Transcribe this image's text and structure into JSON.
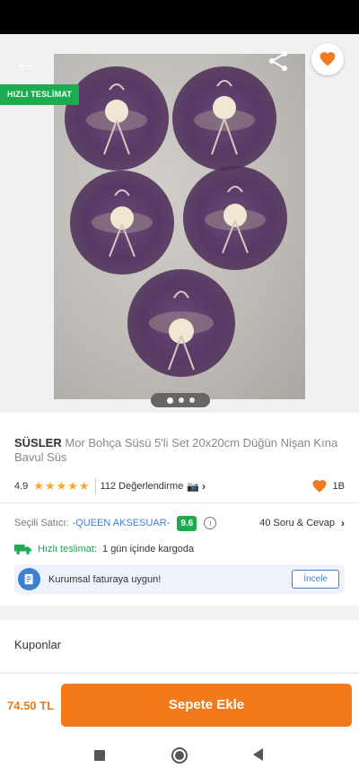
{
  "header": {
    "fast_delivery_badge": "HIZLI TESLİMAT",
    "image_dots": 3,
    "active_dot": 0
  },
  "product": {
    "brand": "SÜSLER",
    "name": "Mor Bohça Süsü 5'li Set 20x20cm Düğün Nişan Kına Bavul Süs",
    "rating": "4.9",
    "stars": "★★★★★",
    "reviews": "112 Değerlendirme",
    "camera_icon": "📷",
    "favorites": "1B"
  },
  "seller": {
    "label": "Seçili Satıcı:",
    "name": "-QUEEN AKSESUAR-",
    "score": "9.6",
    "qa_link": "40 Soru & Cevap"
  },
  "shipping": {
    "label": "Hızlı teslimat:",
    "value": "1 gün içinde kargoda"
  },
  "invoice": {
    "text": "Kurumsal faturaya uygun!",
    "button": "İncele"
  },
  "coupons": {
    "label": "Kuponlar"
  },
  "purchase": {
    "price": "74.50 TL",
    "button": "Sepete Ekle"
  },
  "colors": {
    "accent": "#f27a1a",
    "green": "#1bab50",
    "blue": "#3d7fd0"
  }
}
